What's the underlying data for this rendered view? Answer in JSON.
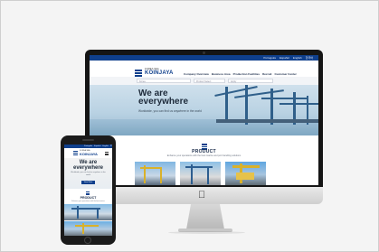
{
  "site": {
    "top_links": [
      "Português",
      "Español",
      "English",
      "한국어"
    ],
    "logo_small": "KOREA SEA",
    "logo_text": "KOINJAYA",
    "menu": [
      "Company Overview",
      "Business Area",
      "Production Facilities",
      "Recruit",
      "Customer Center"
    ],
    "search_fields": [
      "Korea",
      "Product Select",
      "Apply"
    ],
    "hero_title": "We are\neverywhere",
    "hero_subtitle": "Worldwide, you can find us anywhere in the world",
    "product_title": "PRODUCT",
    "product_subtitle": "Enhance your operations with the best marine and port handling solutions",
    "thumb_count_note": ""
  },
  "phone": {
    "top_links": [
      "Português",
      "Español",
      "English",
      "한국어"
    ],
    "logo_small": "KOREA SEA",
    "logo_text": "KOINJAYA",
    "hero_title": "We are\neverywhere",
    "hero_subtitle": "Worldwide, you can find us anywhere in the world",
    "button": "View More",
    "product_title": "PRODUCT",
    "product_subtitle": "Enhance your operations with the best marine"
  },
  "colors": {
    "brand": "#0f3f8c",
    "accent_yellow": "#d9b12a"
  },
  "icons": {
    "apple": "apple-logo-icon",
    "hamburger": "hamburger-menu-icon"
  }
}
